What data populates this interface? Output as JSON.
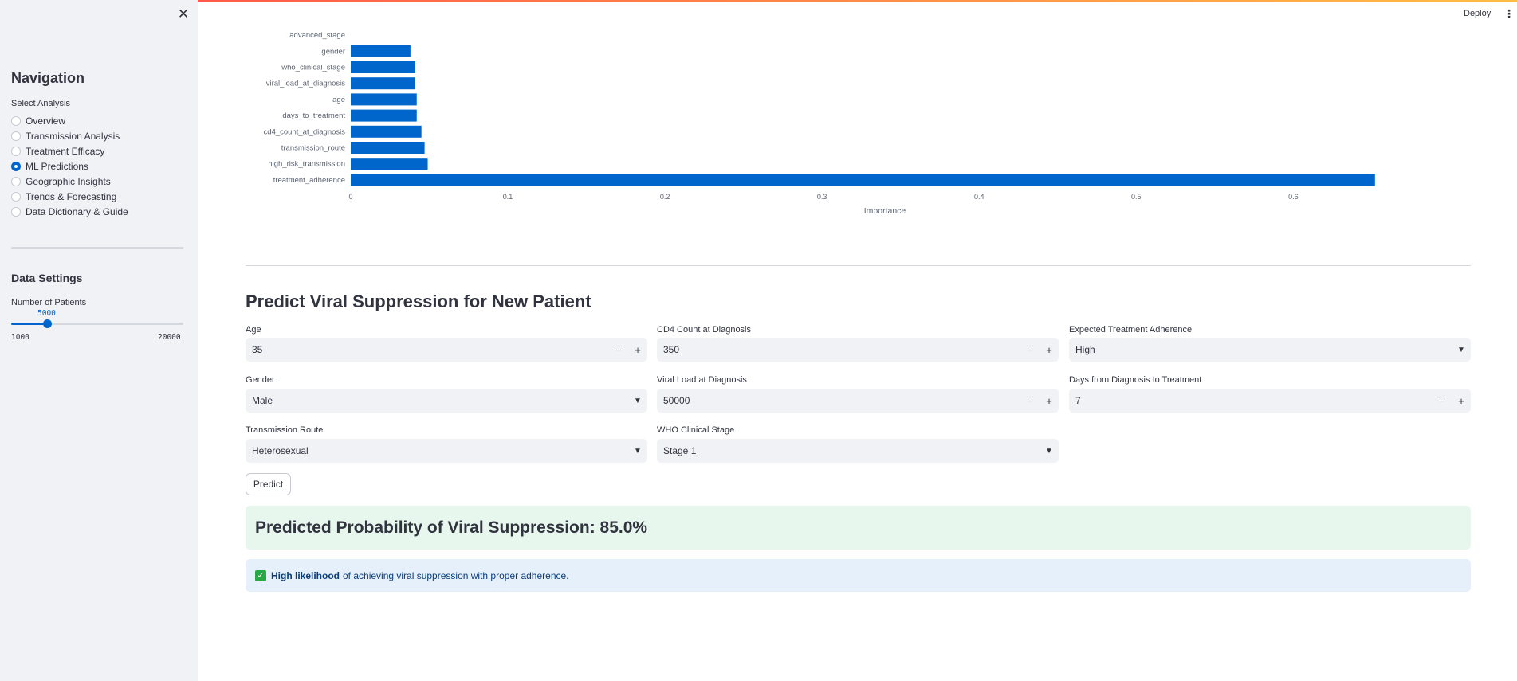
{
  "app": {
    "deploy_label": "Deploy",
    "menu_icon": "kebab-menu-icon"
  },
  "sidebar": {
    "close_icon": "close-icon",
    "nav_title": "Navigation",
    "select_label": "Select Analysis",
    "options": [
      {
        "label": "Overview",
        "selected": false
      },
      {
        "label": "Transmission Analysis",
        "selected": false
      },
      {
        "label": "Treatment Efficacy",
        "selected": false
      },
      {
        "label": "ML Predictions",
        "selected": true
      },
      {
        "label": "Geographic Insights",
        "selected": false
      },
      {
        "label": "Trends & Forecasting",
        "selected": false
      },
      {
        "label": "Data Dictionary & Guide",
        "selected": false
      }
    ],
    "data_settings_title": "Data Settings",
    "slider": {
      "label": "Number of Patients",
      "value": "5000",
      "min": "1000",
      "max": "20000",
      "numeric_value": 5000,
      "numeric_min": 1000,
      "numeric_max": 20000
    }
  },
  "chart_data": {
    "type": "bar",
    "orientation": "horizontal",
    "categories": [
      "advanced_stage",
      "gender",
      "who_clinical_stage",
      "viral_load_at_diagnosis",
      "age",
      "days_to_treatment",
      "cd4_count_at_diagnosis",
      "transmission_route",
      "high_risk_transmission",
      "treatment_adherence"
    ],
    "values": [
      0.0,
      0.038,
      0.041,
      0.041,
      0.042,
      0.042,
      0.045,
      0.047,
      0.049,
      0.652
    ],
    "xlabel": "Importance",
    "ylabel": "",
    "xlim": [
      0,
      0.68
    ],
    "xticks": [
      "0",
      "0.1",
      "0.2",
      "0.3",
      "0.4",
      "0.5",
      "0.6"
    ],
    "xtick_values": [
      0,
      0.1,
      0.2,
      0.3,
      0.4,
      0.5,
      0.6
    ],
    "grid": false,
    "bar_color": "#0066cc"
  },
  "predict": {
    "title": "Predict Viral Suppression for New Patient",
    "age": {
      "label": "Age",
      "value": "35"
    },
    "cd4": {
      "label": "CD4 Count at Diagnosis",
      "value": "350"
    },
    "adherence": {
      "label": "Expected Treatment Adherence",
      "value": "High"
    },
    "gender": {
      "label": "Gender",
      "value": "Male"
    },
    "viral_load": {
      "label": "Viral Load at Diagnosis",
      "value": "50000"
    },
    "days": {
      "label": "Days from Diagnosis to Treatment",
      "value": "7"
    },
    "route": {
      "label": "Transmission Route",
      "value": "Heterosexual"
    },
    "who_stage": {
      "label": "WHO Clinical Stage",
      "value": "Stage 1"
    },
    "minus": "−",
    "plus": "+",
    "chevron": "⌄",
    "button_label": "Predict"
  },
  "result": {
    "text": "Predicted Probability of Viral Suppression: 85.0%",
    "probability_percent": 85.0
  },
  "info": {
    "icon": "check-icon",
    "bold": "High likelihood",
    "rest": "of achieving viral suppression with proper adherence.",
    "color": "#e6f0fa"
  },
  "colors": {
    "accent": "#0066cc",
    "sidebar_bg": "#f0f2f6",
    "success_bg": "#e8f7ee"
  }
}
